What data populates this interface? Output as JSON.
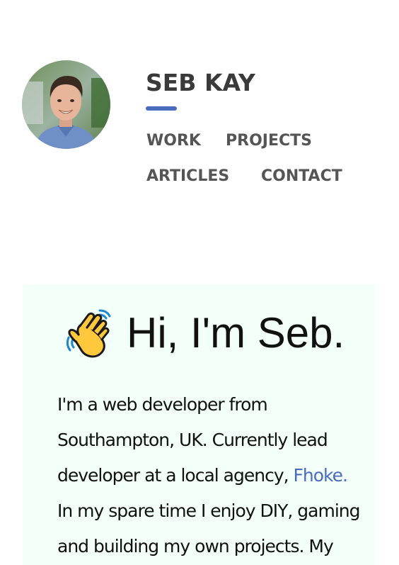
{
  "header": {
    "avatar_alt": "Photo of Seb Kay",
    "site_title": "SEB KAY",
    "accent_color": "#4b6bbd",
    "nav": [
      {
        "label": "WORK"
      },
      {
        "label": "PROJECTS"
      },
      {
        "label": "ARTICLES"
      },
      {
        "label": "CONTACT"
      }
    ]
  },
  "intro": {
    "wave_icon": "waving-hand-icon",
    "greeting": "Hi, I'm Seb.",
    "background_color": "#f3fff9",
    "lines": [
      {
        "text": "I'm a web developer from"
      },
      {
        "text": "Southampton, UK. Currently lead"
      },
      {
        "text": "developer at a local agency, ",
        "link": "Fhoke."
      },
      {
        "text": "In my spare time I enjoy DIY, gaming"
      },
      {
        "text": "and building my own projects. My"
      }
    ]
  }
}
